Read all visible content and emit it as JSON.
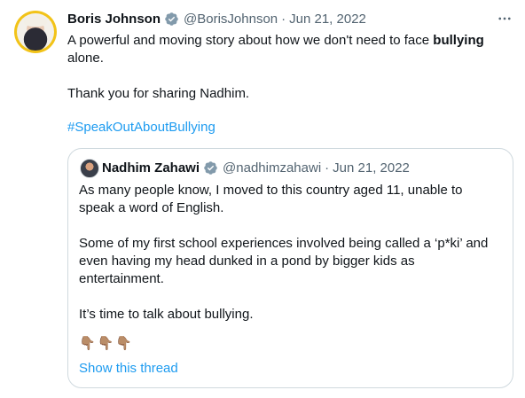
{
  "tweet": {
    "author_name": "Boris Johnson",
    "handle": "@BorisJohnson",
    "separator": "·",
    "date": "Jun 21, 2022",
    "more_icon": "more-horizontal-icon",
    "text_before_bold": "A powerful and moving story about how we don't need to face ",
    "text_bold": "bullying",
    "text_after_bold": " alone.",
    "text_line2": "Thank you for sharing Nadhim.",
    "hashtag": "#SpeakOutAboutBullying"
  },
  "quote": {
    "author_name": "Nadhim Zahawi",
    "handle": "@nadhimzahawi",
    "separator": "·",
    "date": "Jun 21, 2022",
    "paragraphs": [
      "As many people know, I moved to this country aged 11, unable to speak a word of English.",
      "Some of my first school experiences involved being called a ‘p*ki’ and even having my head dunked in a pond by bigger kids as entertainment.",
      "It’s time to talk about bullying."
    ],
    "emojis": "👇🏽👇🏽👇🏽",
    "show_thread": "Show this thread"
  },
  "colors": {
    "verified": "#829aab",
    "link": "#1d9bf0",
    "secondary": "#536471",
    "border": "#cfd9de"
  }
}
